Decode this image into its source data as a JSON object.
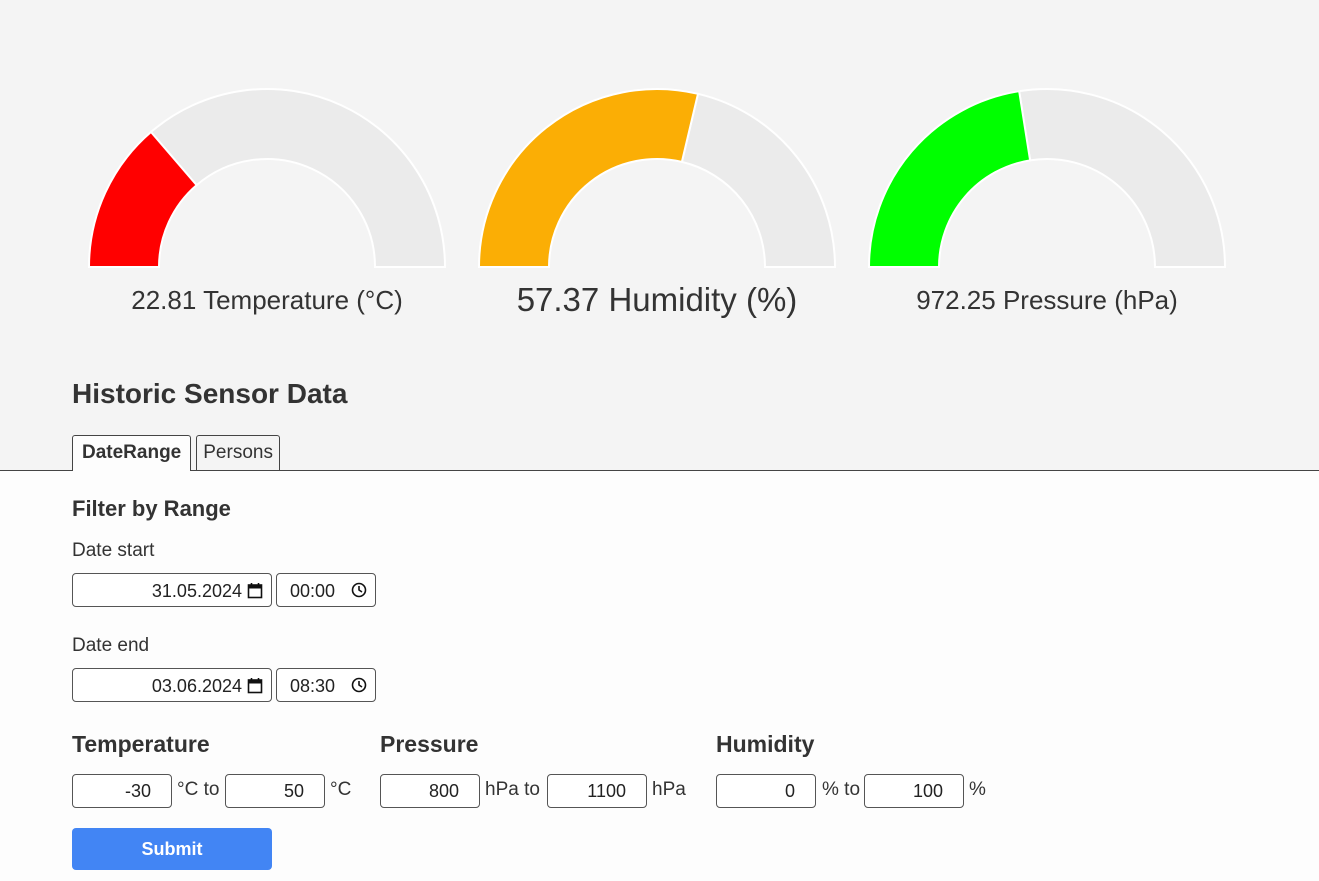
{
  "gauges": [
    {
      "id": "temperature",
      "value": "22.81",
      "label": "Temperature (°C)",
      "fill_fraction": 0.274,
      "color": "#ff0000"
    },
    {
      "id": "humidity",
      "value": "57.37",
      "label": "Humidity (%)",
      "fill_fraction": 0.574,
      "color": "#fbae05"
    },
    {
      "id": "pressure",
      "value": "972.25",
      "label": "Pressure (hPa)",
      "fill_fraction": 0.45,
      "color": "#00ff00"
    }
  ],
  "gauge_track_color": "#ebebeb",
  "section_title": "Historic Sensor Data",
  "tabs": [
    {
      "label": "DateRange",
      "active": true
    },
    {
      "label": "Persons",
      "active": false
    }
  ],
  "filter": {
    "title": "Filter by Range",
    "date_start": {
      "label": "Date start",
      "date": "31.05.2024",
      "time": "00:00"
    },
    "date_end": {
      "label": "Date end",
      "date": "03.06.2024",
      "time": "08:30"
    },
    "temperature": {
      "title": "Temperature",
      "min": "-30",
      "max": "50",
      "unit_to": "°C to",
      "unit": "°C"
    },
    "pressure": {
      "title": "Pressure",
      "min": "800",
      "max": "1100",
      "unit_to": "hPa to",
      "unit": "hPa"
    },
    "humidity": {
      "title": "Humidity",
      "min": "0",
      "max": "100",
      "unit_to": "% to",
      "unit": "%"
    },
    "submit_label": "Submit"
  },
  "accent_color": "#4285f4",
  "icons": {
    "date": "calendar-icon",
    "time": "clock-icon"
  }
}
